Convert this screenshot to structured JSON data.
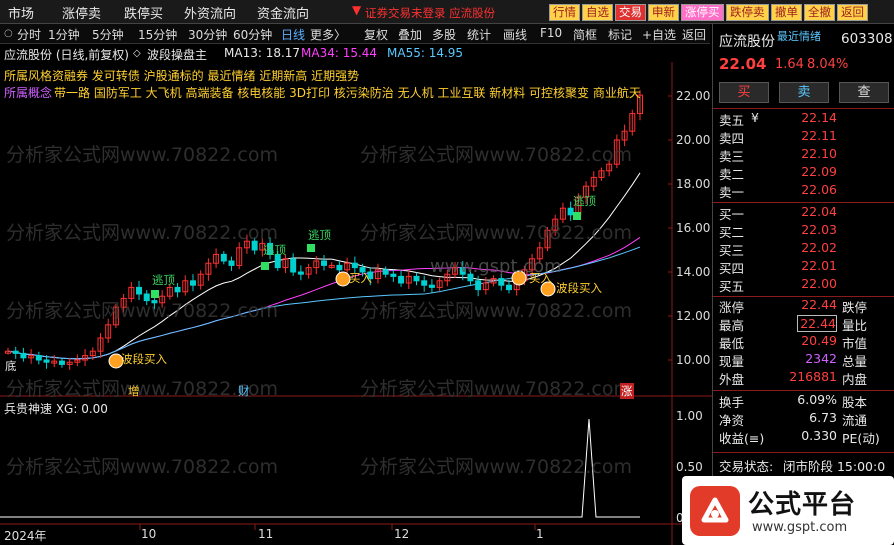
{
  "top_menu": [
    "市场",
    "涨停卖",
    "跌停买",
    "外资流向",
    "资金流向"
  ],
  "top_notice": "证券交易未登录  应流股份",
  "top_buttons": [
    {
      "label": "行情",
      "style": "y"
    },
    {
      "label": "自选",
      "style": "y"
    },
    {
      "label": "交易",
      "style": "r"
    },
    {
      "label": "申新",
      "style": "y"
    },
    {
      "label": "涨停买",
      "style": "p"
    },
    {
      "label": "跌停卖",
      "style": "y"
    },
    {
      "label": "撤单",
      "style": "y"
    },
    {
      "label": "全撤",
      "style": "y"
    },
    {
      "label": "返回",
      "style": "y"
    }
  ],
  "toolbar": {
    "periods": [
      "分时",
      "1分钟",
      "5分钟",
      "15分钟",
      "30分钟",
      "60分钟",
      "日线",
      "更多〉"
    ],
    "active_period": "日线",
    "tools": [
      "复权",
      "叠加",
      "多股",
      "统计",
      "画线",
      "F10",
      "简框",
      "标记",
      "+自选",
      "返回"
    ]
  },
  "chart_info": {
    "stock": "应流股份 (日线,前复权)",
    "indicator": "波段操盘主",
    "ma13": "MA13: 18.17",
    "ma34": "MA34: 15.44",
    "ma55": "MA55: 14.95"
  },
  "concepts": {
    "line1": "所属风格资融券 发可转债 沪股通标的 最近情绪 近期新高 近期强势",
    "line2_label": "所属概念",
    "line2": "带一路 国防军工 大飞机 高端装备 核电核能 3D打印 核污染防治 无人机 工业互联 新材料 可控核聚变 商业航天"
  },
  "watermark": "分析家公式网www.70822.com",
  "watermark2": "www.gspt.com",
  "y_axis": [
    "22.00",
    "20.00",
    "18.00",
    "16.00",
    "14.00",
    "12.00",
    "10.00"
  ],
  "x_axis": [
    "2024年",
    "10",
    "11",
    "12",
    "1"
  ],
  "signals": {
    "escape": "逃顶",
    "buy": "波段买入",
    "buy_short": "买入",
    "bottom": "底",
    "markers": [
      "增",
      "财",
      "涨"
    ]
  },
  "sub_indicator": {
    "title": "兵贵神速  XG: 0.00",
    "y_axis": [
      "1.00",
      "0.50",
      "0.00"
    ]
  },
  "quote": {
    "name": "应流股份",
    "tag": "最近情绪",
    "code": "603308",
    "price": "22.04",
    "change": "1.64",
    "pct": "8.04%",
    "buy_btn": "买",
    "sell_btn": "卖",
    "search_btn": "查",
    "asks": [
      {
        "label": "卖五",
        "price": "22.14"
      },
      {
        "label": "卖四",
        "price": "22.11"
      },
      {
        "label": "卖三",
        "price": "22.10"
      },
      {
        "label": "卖二",
        "price": "22.09"
      },
      {
        "label": "卖一",
        "price": "22.06"
      }
    ],
    "bids": [
      {
        "label": "买一",
        "price": "22.04"
      },
      {
        "label": "买二",
        "price": "22.03"
      },
      {
        "label": "买三",
        "price": "22.02"
      },
      {
        "label": "买四",
        "price": "22.01"
      },
      {
        "label": "买五",
        "price": "22.00"
      }
    ],
    "stats": [
      {
        "l1": "涨停",
        "v1": "22.44",
        "l2": "跌停",
        "c": "red"
      },
      {
        "l1": "最高",
        "v1": "22.44",
        "l2": "量比",
        "c": "red"
      },
      {
        "l1": "最低",
        "v1": "20.49",
        "l2": "市值",
        "c": "red"
      },
      {
        "l1": "现量",
        "v1": "2342",
        "l2": "总量",
        "c": "pur"
      },
      {
        "l1": "外盘",
        "v1": "216881",
        "l2": "内盘",
        "c": "red"
      }
    ],
    "stats2": [
      {
        "l1": "换手",
        "v1": "6.09%",
        "l2": "股本"
      },
      {
        "l1": "净资",
        "v1": "6.73",
        "l2": "流通"
      },
      {
        "l1": "收益(≡)",
        "v1": "0.330",
        "l2": "PE(动)"
      }
    ],
    "status_label": "交易状态:",
    "status_value": "闭市阶段 15:00:0"
  },
  "logo": {
    "text": "公式平台",
    "url": "www.gspt.com"
  }
}
